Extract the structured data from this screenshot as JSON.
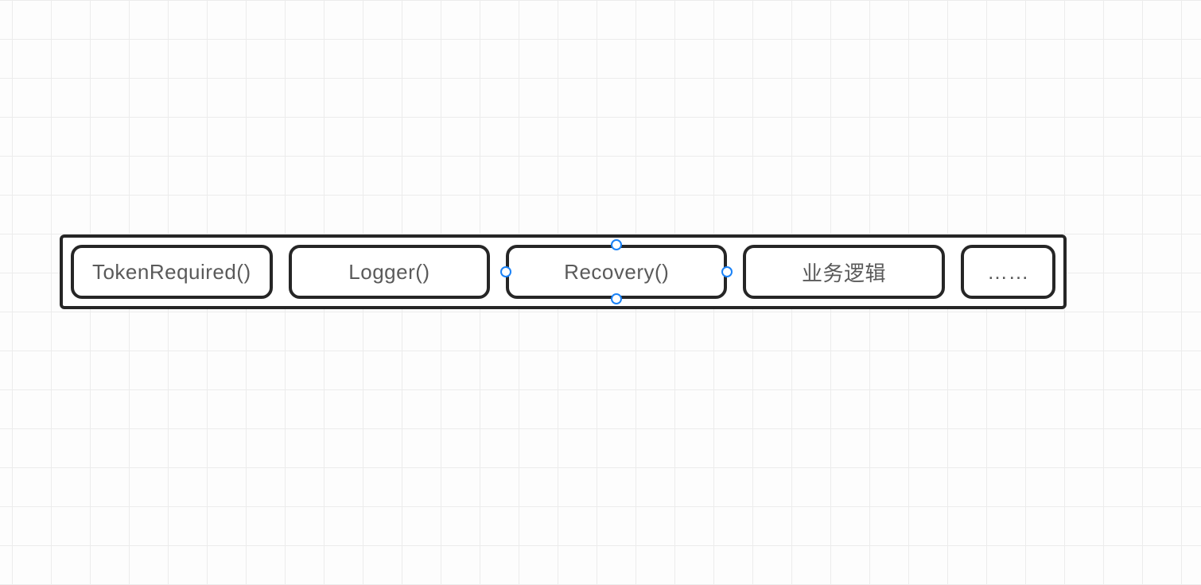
{
  "diagram": {
    "nodes": [
      {
        "label": "TokenRequired()",
        "selected": false
      },
      {
        "label": "Logger()",
        "selected": false
      },
      {
        "label": "Recovery()",
        "selected": true
      },
      {
        "label": "业务逻辑",
        "selected": false
      },
      {
        "label": "……",
        "selected": false
      }
    ]
  }
}
